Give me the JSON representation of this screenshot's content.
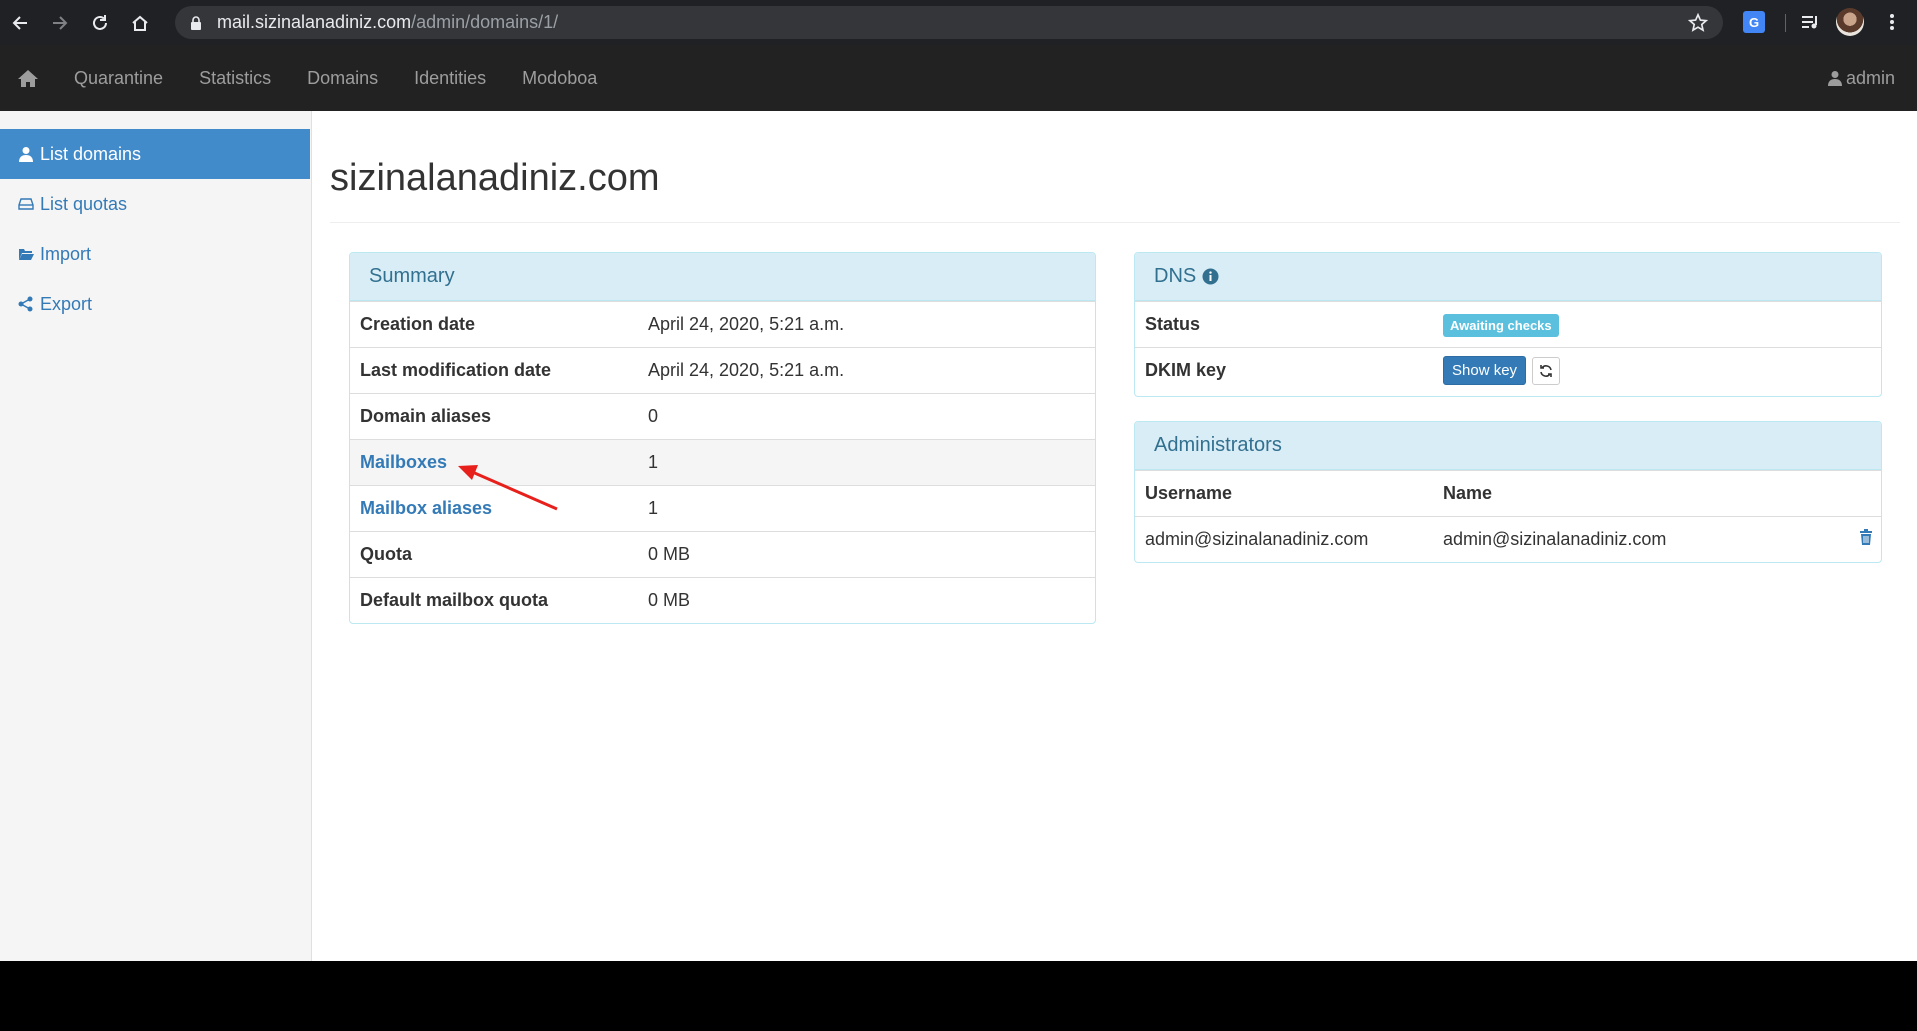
{
  "browser": {
    "url_host": "mail.sizinalanadiniz.com",
    "url_path": "/admin/domains/1/"
  },
  "navbar": {
    "links": [
      "Quarantine",
      "Statistics",
      "Domains",
      "Identities",
      "Modoboa"
    ],
    "user": "admin"
  },
  "sidebar": {
    "items": [
      {
        "label": "List domains",
        "icon": "user-icon"
      },
      {
        "label": "List quotas",
        "icon": "hdd-icon"
      },
      {
        "label": "Import",
        "icon": "folder-open-icon"
      },
      {
        "label": "Export",
        "icon": "share-icon"
      }
    ]
  },
  "main": {
    "title": "sizinalanadiniz.com"
  },
  "summary": {
    "heading": "Summary",
    "rows": [
      {
        "label": "Creation date",
        "value": "April 24, 2020, 5:21 a.m."
      },
      {
        "label": "Last modification date",
        "value": "April 24, 2020, 5:21 a.m."
      },
      {
        "label": "Domain aliases",
        "value": "0"
      },
      {
        "label": "Mailboxes",
        "value": "1"
      },
      {
        "label": "Mailbox aliases",
        "value": "1"
      },
      {
        "label": "Quota",
        "value": "0 MB"
      },
      {
        "label": "Default mailbox quota",
        "value": "0 MB"
      }
    ]
  },
  "dns": {
    "heading": "DNS",
    "status_label": "Status",
    "status_value": "Awaiting checks",
    "dkim_label": "DKIM key",
    "show_key": "Show key"
  },
  "admins": {
    "heading": "Administrators",
    "col_username": "Username",
    "col_name": "Name",
    "rows": [
      {
        "username": "admin@sizinalanadiniz.com",
        "name": "admin@sizinalanadiniz.com"
      }
    ]
  },
  "colors": {
    "navbar_bg": "#222222",
    "active_sidebar": "#428bca",
    "link": "#337ab7",
    "panel_heading_bg": "#d9edf7",
    "badge_info": "#5bc0de",
    "annotation_arrow": "#e8201c"
  }
}
